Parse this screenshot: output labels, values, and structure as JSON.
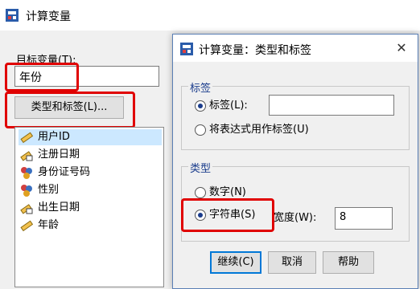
{
  "main_window": {
    "title": "计算变量",
    "target_label": "目标变量(T):",
    "target_value": "年份",
    "type_label_button": "类型和标签(L)...",
    "variables": [
      {
        "name": "用户ID",
        "icon": "ruler-scale-icon",
        "selected": true
      },
      {
        "name": "注册日期",
        "icon": "date-scale-icon"
      },
      {
        "name": "身份证号码",
        "icon": "nominal-string-icon"
      },
      {
        "name": "性别",
        "icon": "nominal-string-icon"
      },
      {
        "name": "出生日期",
        "icon": "date-scale-icon"
      },
      {
        "name": "年龄",
        "icon": "ruler-scale-icon"
      }
    ]
  },
  "dialog": {
    "title": "计算变量：类型和标签",
    "label_group": {
      "legend": "标签",
      "option_label": "标签(L):",
      "option_label_selected": true,
      "label_value": "",
      "option_expr": "将表达式用作标签(U)"
    },
    "type_group": {
      "legend": "类型",
      "option_numeric": "数字(N)",
      "option_string": "字符串(S)",
      "string_selected": true,
      "width_label": "宽度(W):",
      "width_value": "8"
    },
    "buttons": {
      "continue": "继续(C)",
      "cancel": "取消",
      "help": "帮助"
    }
  },
  "colors": {
    "highlight_box": "#e00000",
    "selected_row": "#cce8ff",
    "legend_text": "#1a3c8c"
  }
}
